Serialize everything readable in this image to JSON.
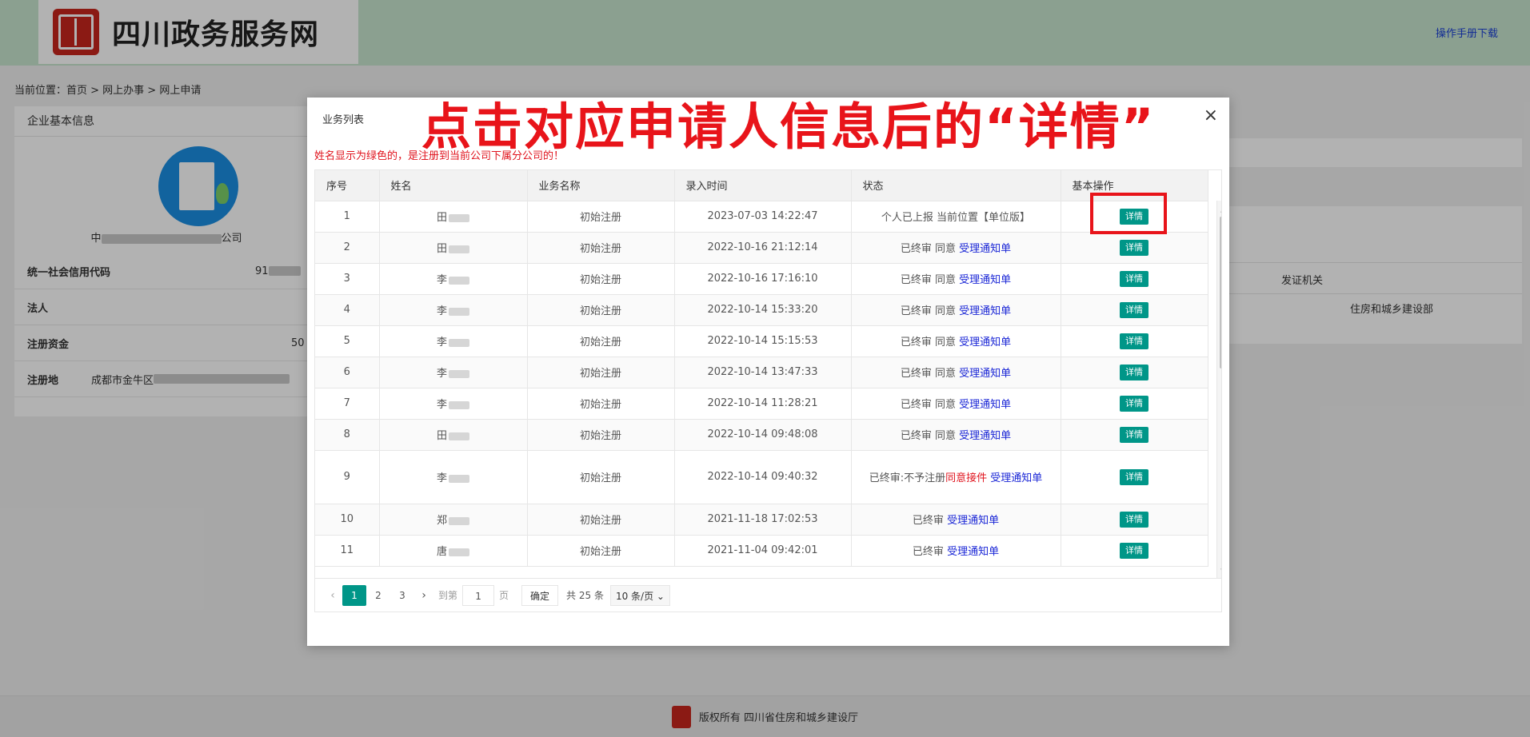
{
  "header": {
    "site_title": "四川政务服务网",
    "manual_link": "操作手册下载"
  },
  "breadcrumb": "当前位置：首页 > 网上办事 > 网上申请",
  "left_panel": {
    "title": "企业基本信息",
    "company_prefix": "中",
    "company_suffix": "公司",
    "rows": [
      {
        "key": "统一社会信用代码",
        "val": "91"
      },
      {
        "key": "法人",
        "val": ""
      },
      {
        "key": "注册资金",
        "val": "50"
      },
      {
        "key": "注册地",
        "val": "成都市金牛区"
      }
    ]
  },
  "right_panel": {
    "header": "发证机关",
    "value": "住房和城乡建设部"
  },
  "footer": {
    "text": "版权所有 四川省住房和城乡建设厅"
  },
  "modal": {
    "title": "业务列表",
    "close_glyph": "×",
    "notice": "姓名显示为绿色的，是注册到当前公司下属分公司的！",
    "caption": "点击对应申请人信息后的“详情”",
    "columns": [
      "序号",
      "姓名",
      "业务名称",
      "录入时间",
      "状态",
      "基本操作"
    ],
    "detail_label": "详情",
    "rows": [
      {
        "no": "1",
        "name": "田",
        "biz": "初始注册",
        "time": "2023-07-03 14:22:47",
        "status": "个人已上报 当前位置【单位版】",
        "status_link": "",
        "status_red": ""
      },
      {
        "no": "2",
        "name": "田",
        "biz": "初始注册",
        "time": "2022-10-16 21:12:14",
        "status": "已终审 同意 ",
        "status_link": "受理通知单",
        "status_red": ""
      },
      {
        "no": "3",
        "name": "李",
        "biz": "初始注册",
        "time": "2022-10-16 17:16:10",
        "status": "已终审 同意 ",
        "status_link": "受理通知单",
        "status_red": ""
      },
      {
        "no": "4",
        "name": "李",
        "biz": "初始注册",
        "time": "2022-10-14 15:33:20",
        "status": "已终审 同意 ",
        "status_link": "受理通知单",
        "status_red": ""
      },
      {
        "no": "5",
        "name": "李",
        "biz": "初始注册",
        "time": "2022-10-14 15:15:53",
        "status": "已终审 同意 ",
        "status_link": "受理通知单",
        "status_red": ""
      },
      {
        "no": "6",
        "name": "李",
        "biz": "初始注册",
        "time": "2022-10-14 13:47:33",
        "status": "已终审 同意 ",
        "status_link": "受理通知单",
        "status_red": ""
      },
      {
        "no": "7",
        "name": "李",
        "biz": "初始注册",
        "time": "2022-10-14 11:28:21",
        "status": "已终审 同意 ",
        "status_link": "受理通知单",
        "status_red": ""
      },
      {
        "no": "8",
        "name": "田",
        "biz": "初始注册",
        "time": "2022-10-14 09:48:08",
        "status": "已终审 同意 ",
        "status_link": "受理通知单",
        "status_red": ""
      },
      {
        "no": "9",
        "name": "李",
        "biz": "初始注册",
        "time": "2022-10-14 09:40:32",
        "status": "已终审:不予注册",
        "status_red": "同意接件",
        "status_link": " 受理通知单"
      },
      {
        "no": "10",
        "name": "郑",
        "biz": "初始注册",
        "time": "2021-11-18 17:02:53",
        "status": "已终审 ",
        "status_link": "受理通知单",
        "status_red": ""
      },
      {
        "no": "11",
        "name": "唐",
        "biz": "初始注册",
        "time": "2021-11-04 09:42:01",
        "status": "已终审 ",
        "status_link": "受理通知单",
        "status_red": ""
      }
    ],
    "pager": {
      "pages": [
        "1",
        "2",
        "3"
      ],
      "goto_label": "到第",
      "goto_value": "1",
      "page_unit": "页",
      "ok_label": "确定",
      "total": "共 25 条",
      "page_size": "10 条/页 ⌄"
    }
  }
}
